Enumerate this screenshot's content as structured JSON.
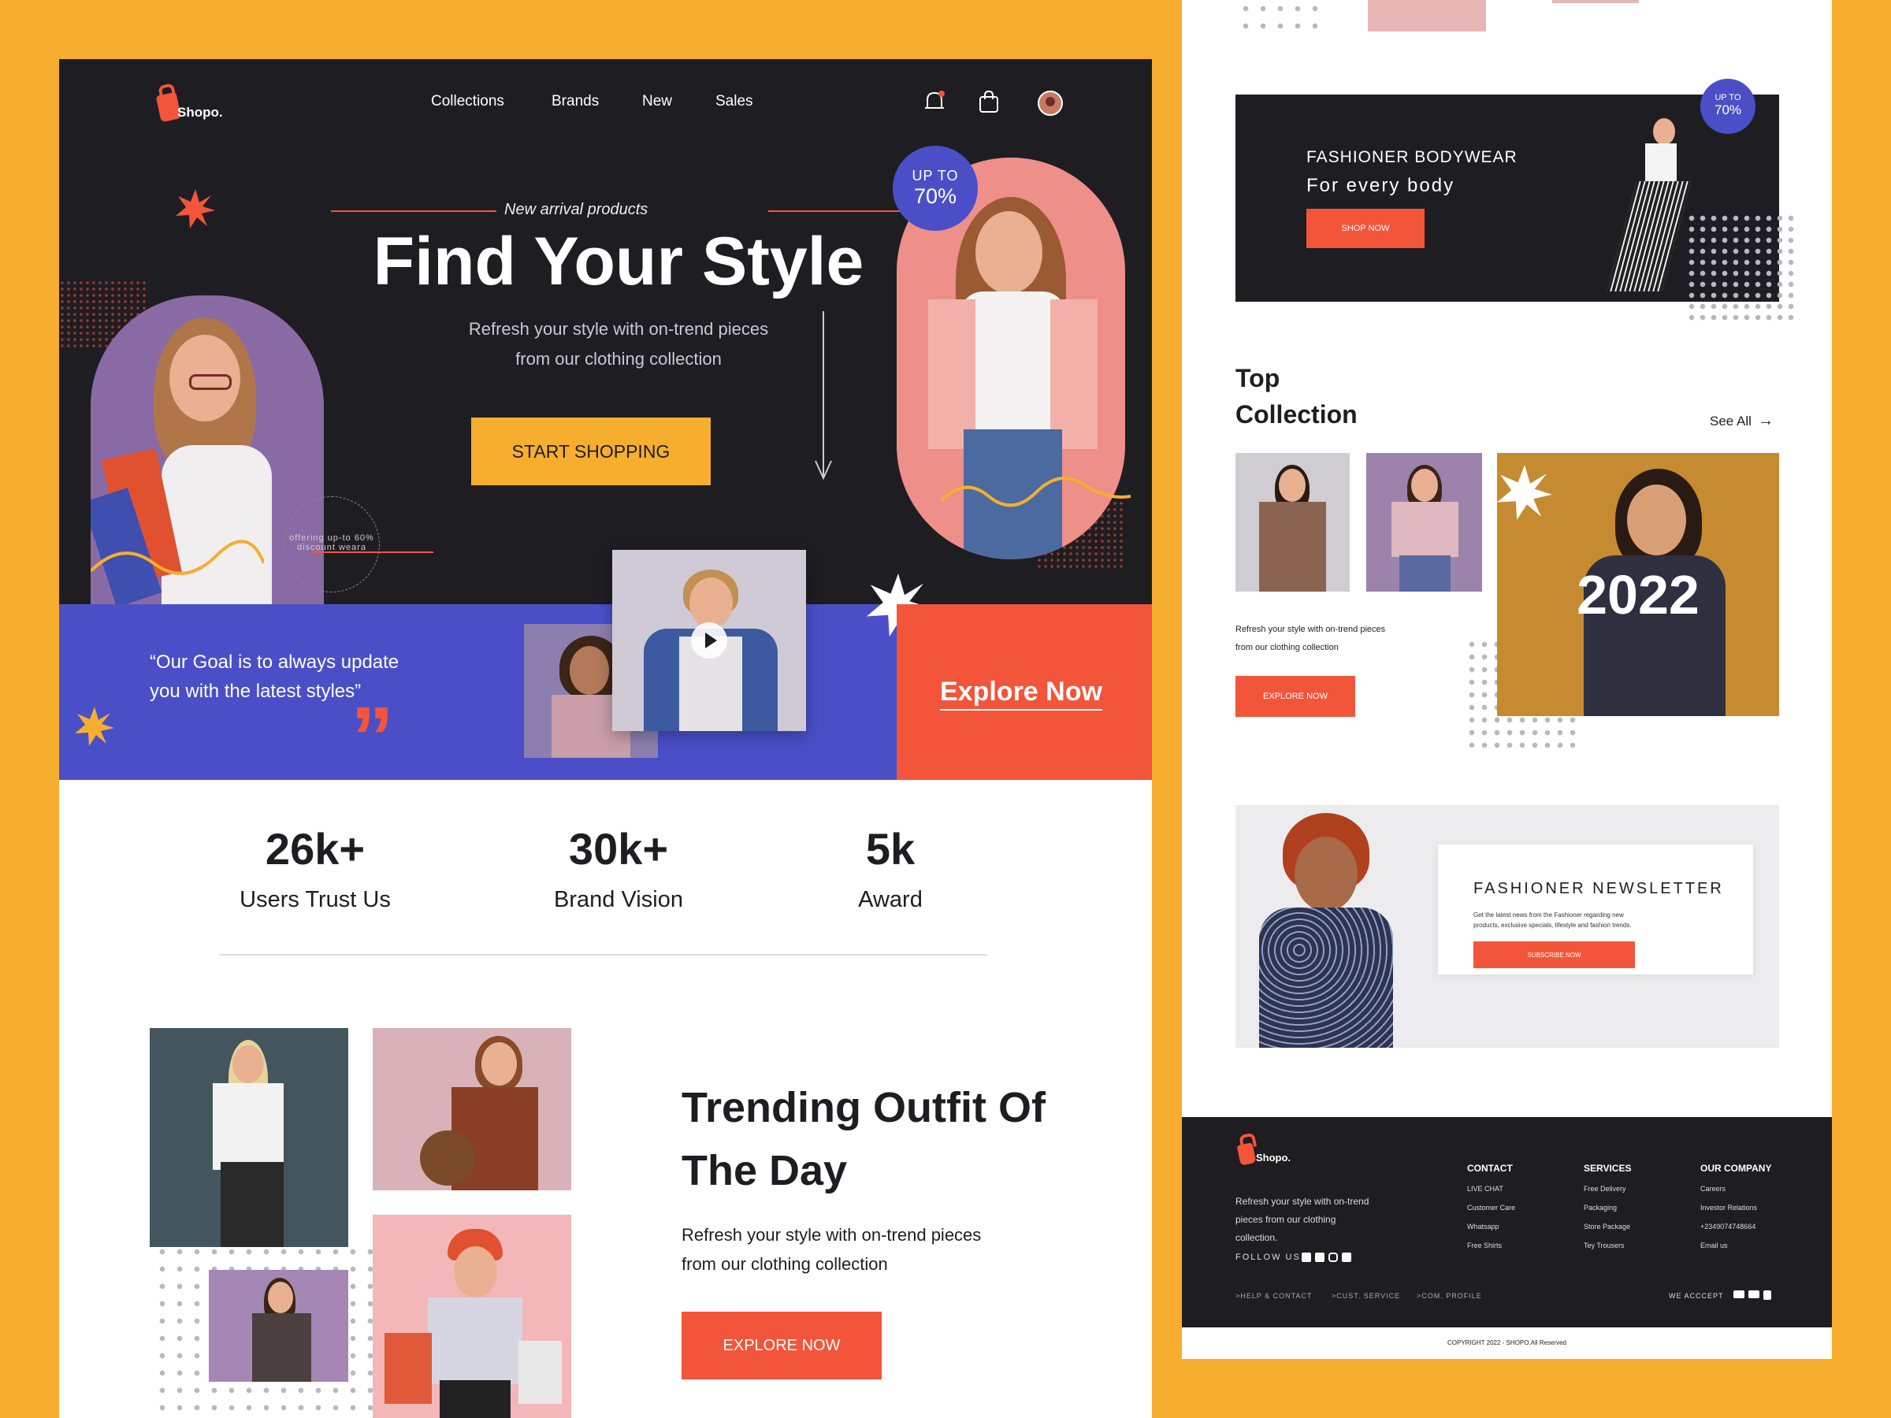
{
  "left": {
    "logo": "Shopo.",
    "nav": [
      "Collections",
      "Brands",
      "New",
      "Sales"
    ],
    "icons": {
      "bell": "bell-icon",
      "bag": "shopping-bag-icon",
      "avatar": "avatar"
    },
    "hero": {
      "eyebrow": "New arrival products",
      "title": "Find Your Style",
      "subtitle_line1": "Refresh your style with on-trend pieces",
      "subtitle_line2": "from our clothing collection",
      "cta": "START SHOPPING",
      "badge_top": "UP TO",
      "badge_bottom": "70%",
      "circular_text": "offering up-to 60% discount weara"
    },
    "band": {
      "quote_line1": "“Our Goal is to always update",
      "quote_line2": "you with the latest styles”",
      "explore": "Explore Now"
    },
    "stats": [
      {
        "value": "26k+",
        "label": "Users Trust Us"
      },
      {
        "value": "30k+",
        "label": "Brand Vision"
      },
      {
        "value": "5k",
        "label": "Award"
      }
    ],
    "trending": {
      "title_line1": "Trending Outfit Of",
      "title_line2": "The Day",
      "desc_line1": "Refresh your style with on-trend pieces",
      "desc_line2": "from our clothing collection",
      "cta": "EXPLORE NOW"
    }
  },
  "right": {
    "banner": {
      "title": "FASHIONER BODYWEAR",
      "subtitle": "For every body",
      "cta": "SHOP NOW",
      "badge_top": "UP TO",
      "badge_bottom": "70%"
    },
    "top_collection": {
      "title_line1": "Top",
      "title_line2": "Collection",
      "see_all": "See All",
      "year": "2022",
      "desc_line1": "Refresh your style with on-trend pieces",
      "desc_line2": "from our clothing collection",
      "cta": "EXPLORE NOW"
    },
    "newsletter": {
      "title": "FASHIONER NEWSLETTER",
      "desc_line1": "Get the latest news from the Fashioner  regarding new",
      "desc_line2": "products, exclusive specials, lifestyle and fashion trends.",
      "cta": "SUBSCRIBE NOW"
    },
    "footer": {
      "logo": "Shopo.",
      "desc_line1": "Refresh your style with on-trend",
      "desc_line2": "pieces from our clothing",
      "desc_line3": "collection.",
      "follow": "FOLLOW US",
      "columns": [
        {
          "head": "CONTACT",
          "items": [
            "LIVE CHAT",
            "Customer Care",
            "Whatsapp",
            "Free Shirts"
          ]
        },
        {
          "head": "SERVICES",
          "items": [
            "Free Delivery",
            "Packaging",
            "Store Package",
            "Tey Trousers"
          ]
        },
        {
          "head": "OUR COMPANY",
          "items": [
            "Careers",
            "Investor Relations",
            "+2349074748664",
            "Email us"
          ]
        }
      ],
      "bottom_links": [
        ">HELP & CONTACT",
        ">CUST. SERVICE",
        ">COM. PROFILE"
      ],
      "accept": "WE ACCCEPT",
      "copyright": "COPYRIGHT 2022 - SHOPO.All Reserved"
    }
  },
  "colors": {
    "background": "#f7ae2e",
    "dark": "#1e1d22",
    "orange": "#f2553a",
    "blue": "#4a4fc8",
    "yellow": "#f7ae2e"
  }
}
